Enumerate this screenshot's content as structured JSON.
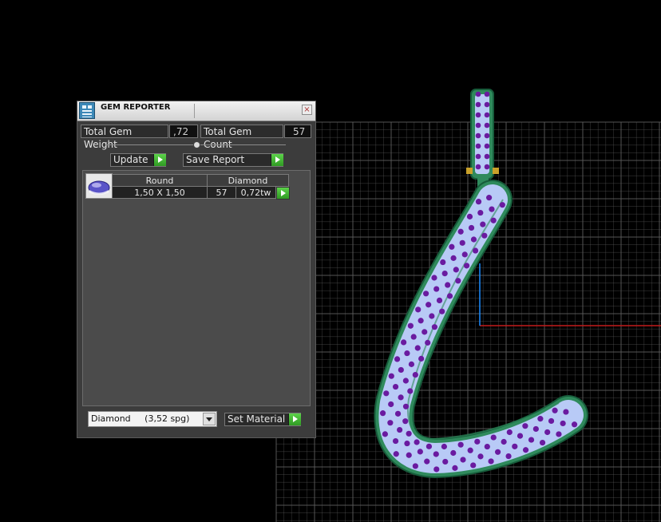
{
  "window": {
    "title": "GEM REPORTER",
    "close_symbol": "×",
    "app_icon": "gem-reporter-icon"
  },
  "summary": {
    "weight_label": "Total Gem Weight",
    "weight_value": ",72",
    "count_label": "Total Gem Count",
    "count_value": "57"
  },
  "actions": {
    "update_label": "Update",
    "save_report_label": "Save Report",
    "set_material_label": "Set Material"
  },
  "table": {
    "headers": [
      "Round",
      "Diamond"
    ],
    "rows": [
      {
        "size": "1,50 X 1,50",
        "count": "57",
        "weight": "0,72tw"
      }
    ]
  },
  "material": {
    "selected": "Diamond",
    "spg": "(3,52 spg)"
  },
  "colors": {
    "panel_bg": "#3c3c3c",
    "accent_green": "#3fb42e",
    "gem_fill": "#b8caf6",
    "prong_purple": "#6a1aa0",
    "metal_green": "#2f8a5c",
    "grid": "#5e5e5e",
    "axis_x": "#c21a1a",
    "axis_y": "#1a8cff"
  }
}
